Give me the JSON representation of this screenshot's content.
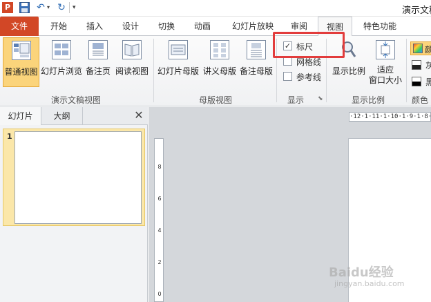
{
  "quick_access": {
    "app_logo": "P",
    "doc_title": "演示文稿"
  },
  "tabs": {
    "file": "文件",
    "home": "开始",
    "insert": "插入",
    "design": "设计",
    "transitions": "切换",
    "animations": "动画",
    "slideshow": "幻灯片放映",
    "review": "审阅",
    "view": "视图",
    "features": "特色功能",
    "active": "视图"
  },
  "ribbon": {
    "presentation_views": {
      "label": "演示文稿视图",
      "buttons": [
        "普通视图",
        "幻灯片浏览",
        "备注页",
        "阅读视图"
      ],
      "active": "普通视图"
    },
    "master_views": {
      "label": "母版视图",
      "buttons": [
        "幻灯片母版",
        "讲义母版",
        "备注母版"
      ]
    },
    "show": {
      "label": "显示",
      "ruler": {
        "label": "标尺",
        "checked": true
      },
      "gridlines": {
        "label": "网格线",
        "checked": false
      },
      "guides": {
        "label": "参考线",
        "checked": false
      },
      "ruler_mark": "✓"
    },
    "zoom": {
      "label": "显示比例",
      "zoom_button": "显示比例",
      "fit_button_line1": "适应",
      "fit_button_line2": "窗口大小"
    },
    "color": {
      "label": "颜色",
      "items": [
        "颜",
        "灰",
        "黑"
      ]
    }
  },
  "left_panel": {
    "tab_slides": "幻灯片",
    "tab_outline": "大纲",
    "close_glyph": "✕",
    "slide_number": "1"
  },
  "rulers": {
    "horizontal": "·12·1·11·1·10·1·9·1·8·",
    "vertical": [
      "8",
      "6",
      "4",
      "2",
      "0"
    ]
  },
  "watermark": {
    "brand": "Baidu经验",
    "url": "jingyan.baidu.com"
  },
  "colors": {
    "file_tab": "#d24726",
    "active_button": "#fbd47b",
    "highlight_box": "#e23c3c",
    "canvas_bg": "#d4d7db"
  }
}
